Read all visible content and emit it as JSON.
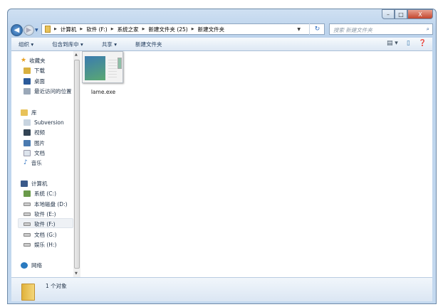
{
  "window": {
    "controls": {
      "minimize": "–",
      "maximize": "□",
      "close": "X"
    }
  },
  "address": {
    "crumbs": [
      "计算机",
      "软件 (F:)",
      "系统之家",
      "新建文件夹 (25)",
      "新建文件夹"
    ]
  },
  "search": {
    "placeholder": "搜索 新建文件夹"
  },
  "toolbar": {
    "organize": "组织 ▾",
    "include": "包含到库中 ▾",
    "share": "共享 ▾",
    "new_folder": "新建文件夹"
  },
  "nav": {
    "favorites": {
      "label": "收藏夹",
      "items": [
        "下载",
        "桌面",
        "最近访问的位置"
      ]
    },
    "libraries": {
      "label": "库",
      "items": [
        "Subversion",
        "视频",
        "图片",
        "文档",
        "音乐"
      ]
    },
    "computer": {
      "label": "计算机",
      "items": [
        "系统 (C:)",
        "本地磁盘 (D:)",
        "软件 (E:)",
        "软件 (F:)",
        "文档 (G:)",
        "娱乐 (H:)"
      ],
      "selected": "软件 (F:)"
    },
    "network": {
      "label": "网络"
    }
  },
  "files": [
    {
      "name": "lame.exe"
    }
  ],
  "status": {
    "text": "1 个对象"
  }
}
